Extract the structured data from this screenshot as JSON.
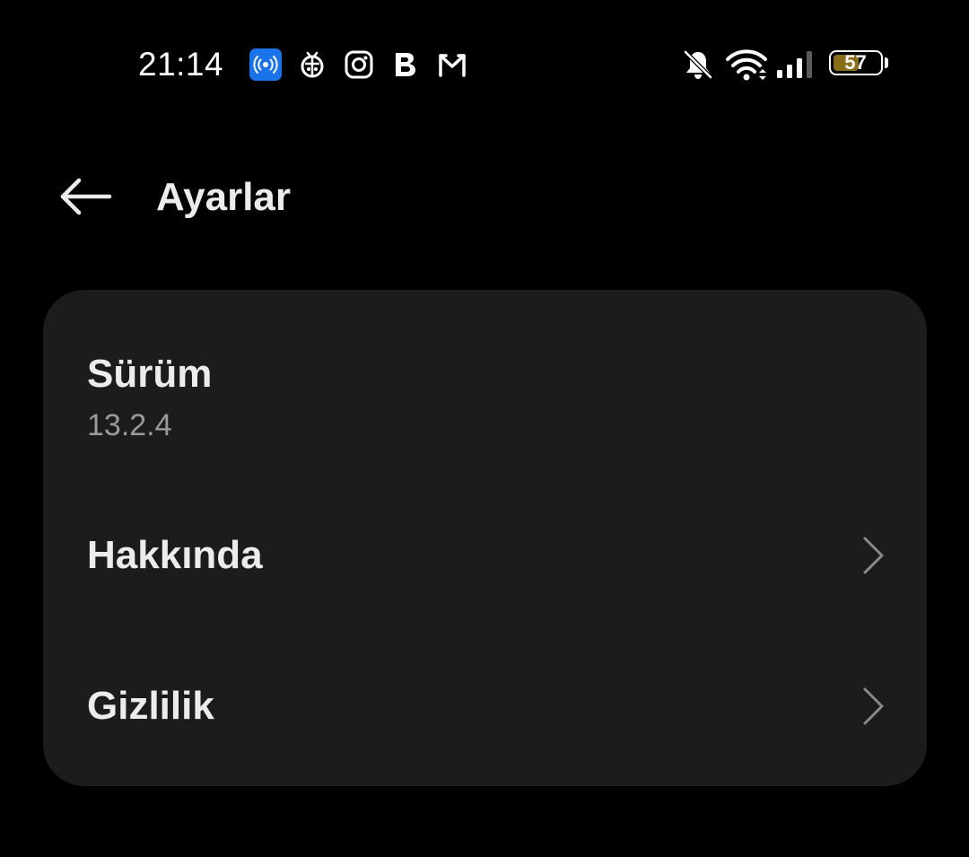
{
  "status_bar": {
    "time": "21:14",
    "notification_icons": [
      "hotspot-icon",
      "bug-icon",
      "instagram-icon",
      "b-app-icon",
      "mail-icon"
    ],
    "system_icons": [
      "notifications-muted-icon",
      "wifi-icon",
      "signal-icon",
      "battery-icon"
    ],
    "battery_level": "57",
    "battery_fraction": 0.57,
    "battery_color": "#8a6d18",
    "hotspot_color": "#1a73e8"
  },
  "app_bar": {
    "back_icon": "arrow-left-icon",
    "title": "Ayarlar"
  },
  "settings": {
    "version": {
      "label": "Sürüm",
      "value": "13.2.4"
    },
    "items": [
      {
        "label": "Hakkında",
        "icon": "chevron-right-icon"
      },
      {
        "label": "Gizlilik",
        "icon": "chevron-right-icon"
      }
    ]
  },
  "colors": {
    "background": "#000000",
    "card": "#1c1c1c",
    "primary_text": "#ececec",
    "secondary_text": "#9a9a9a",
    "chevron": "#8a8a8a"
  }
}
